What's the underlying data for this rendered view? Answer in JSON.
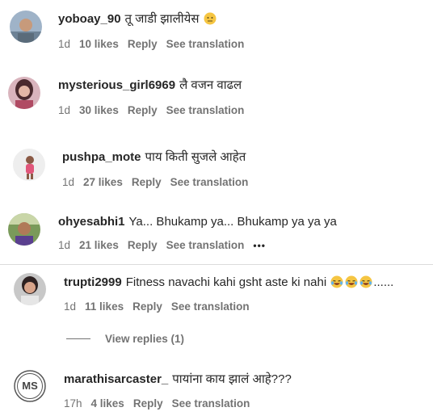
{
  "comments": [
    {
      "username": "yoboay_90",
      "text": "तू जाडी झालीयेस",
      "emoji": "neutral-face",
      "time": "1d",
      "likes": "10 likes",
      "reply": "Reply",
      "translate": "See translation"
    },
    {
      "username": "mysterious_girl6969",
      "text": "लै वजन वाढल",
      "time": "1d",
      "likes": "30 likes",
      "reply": "Reply",
      "translate": "See translation"
    },
    {
      "username": "pushpa_mote",
      "text": "पाय किती सुजले आहेत",
      "time": "1d",
      "likes": "27 likes",
      "reply": "Reply",
      "translate": "See translation"
    },
    {
      "username": "ohyesabhi1",
      "text": "Ya... Bhukamp ya... Bhukamp ya ya ya",
      "time": "1d",
      "likes": "21 likes",
      "reply": "Reply",
      "translate": "See translation",
      "more": "•••"
    },
    {
      "username": "trupti2999",
      "text": "Fitness navachi kahi gsht aste ki nahi",
      "trailing": "......",
      "emoji": "laughing-tears",
      "time": "1d",
      "likes": "11 likes",
      "reply": "Reply",
      "translate": "See translation"
    },
    {
      "username": "marathisarcaster_",
      "text": "पायांना काय झालं आहे???",
      "avatar_initials": "MS",
      "time": "17h",
      "likes": "4 likes",
      "reply": "Reply",
      "translate": "See translation"
    }
  ],
  "view_replies": "View replies (1)",
  "colors": {
    "text": "#262626",
    "secondary": "#737373",
    "divider": "#dbdbdb",
    "emoji": "#f5c542"
  }
}
